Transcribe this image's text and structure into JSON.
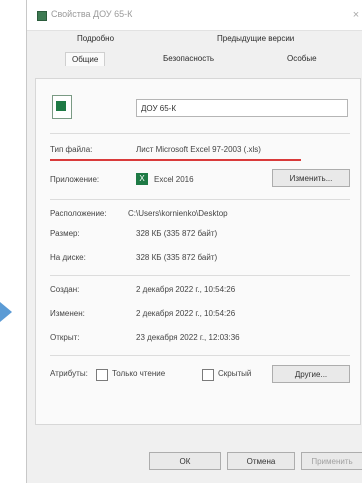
{
  "window": {
    "title": "Свойства ДОУ 65-К"
  },
  "tabs": {
    "row1": [
      "Подробно",
      "Предыдущие версии"
    ],
    "row2": [
      "Общие",
      "Безопасность",
      "Особые"
    ],
    "active": "Общие"
  },
  "general": {
    "file_name": "ДОУ 65-К",
    "file_type_label": "Тип файла:",
    "file_type_value": "Лист Microsoft Excel 97-2003 (.xls)",
    "app_label": "Приложение:",
    "app_name": "Excel 2016",
    "change_button": "Изменить...",
    "location_label": "Расположение:",
    "location_value": "C:\\Users\\kornienko\\Desktop",
    "size_label": "Размер:",
    "size_value": "328 КБ (335 872 байт)",
    "disk_label": "На диске:",
    "disk_value": "328 КБ (335 872 байт)",
    "created_label": "Создан:",
    "created_value": "2 декабря 2022 г., 10:54:26",
    "modified_label": "Изменен:",
    "modified_value": "2 декабря 2022 г., 10:54:26",
    "opened_label": "Открыт:",
    "opened_value": "23 декабря 2022 г., 12:03:36",
    "attributes_label": "Атрибуты:",
    "readonly_label": "Только чтение",
    "hidden_label": "Скрытый",
    "other_button": "Другие..."
  },
  "footer": {
    "ok": "ОК",
    "cancel": "Отмена",
    "apply": "Применить"
  },
  "colors": {
    "highlight_underline": "#d93a3a",
    "excel_green": "#1e7a45",
    "arrow_blue": "#5b9bd5"
  }
}
